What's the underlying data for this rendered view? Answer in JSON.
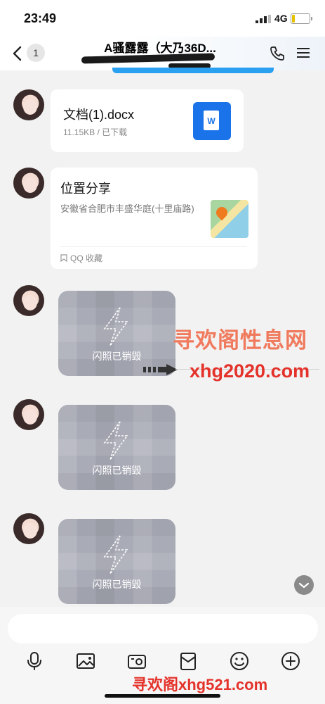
{
  "status_bar": {
    "time": "23:49",
    "network": "4G",
    "battery_level": 0.2,
    "battery_color": "#e6c200"
  },
  "nav": {
    "unread_count": "1",
    "title": "A骚露露（大乃36D..."
  },
  "messages": [
    {
      "type": "file",
      "file_name": "文档(1).docx",
      "file_meta": "11.15KB / 已下载",
      "file_icon_letter": "W"
    },
    {
      "type": "location",
      "title": "位置分享",
      "address": "安徽省合肥市丰盛华庭(十里庙路)",
      "source": "QQ 收藏"
    },
    {
      "type": "flash_photo",
      "text": "闪照已销毁"
    },
    {
      "type": "flash_photo",
      "text": "闪照已销毁"
    },
    {
      "type": "flash_photo",
      "text": "闪照已销毁"
    }
  ],
  "watermarks": {
    "top_line": "寻欢阁性息网",
    "url": "xhg2020.com",
    "bottom": "寻欢阁xhg521.com"
  },
  "toolbar": [
    "mic-icon",
    "image-icon",
    "camera-icon",
    "red-packet-icon",
    "emoji-icon",
    "plus-icon"
  ],
  "colors": {
    "accent": "#1a73e8",
    "watermark_red": "#e4322a"
  }
}
